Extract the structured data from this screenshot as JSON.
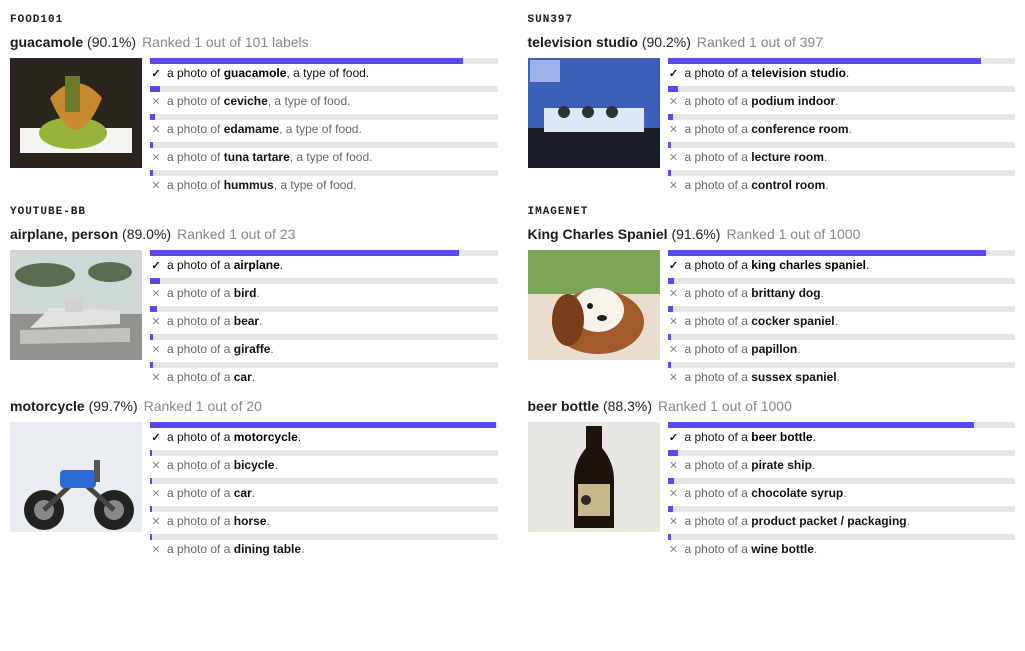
{
  "columns": [
    {
      "blocks": [
        {
          "dataset": "FOOD101",
          "examples": [
            {
              "label": "guacamole",
              "score": "(90.1%)",
              "rank": "Ranked 1 out of 101 labels",
              "thumb": "guacamole",
              "predictions": [
                {
                  "prefix": "a photo of ",
                  "bold": "guacamole",
                  "suffix": ", a type of food.",
                  "pct": 90.1,
                  "correct": true
                },
                {
                  "prefix": "a photo of ",
                  "bold": "ceviche",
                  "suffix": ", a type of food.",
                  "pct": 3,
                  "correct": false
                },
                {
                  "prefix": "a photo of ",
                  "bold": "edamame",
                  "suffix": ", a type of food.",
                  "pct": 1.5,
                  "correct": false
                },
                {
                  "prefix": "a photo of ",
                  "bold": "tuna tartare",
                  "suffix": ", a type of food.",
                  "pct": 1,
                  "correct": false
                },
                {
                  "prefix": "a photo of ",
                  "bold": "hummus",
                  "suffix": ", a type of food.",
                  "pct": 1,
                  "correct": false
                }
              ]
            }
          ]
        },
        {
          "dataset": "YOUTUBE-BB",
          "examples": [
            {
              "label": "airplane, person",
              "score": "(89.0%)",
              "rank": "Ranked 1 out of 23",
              "thumb": "airplane",
              "predictions": [
                {
                  "prefix": "a photo of a ",
                  "bold": "airplane",
                  "suffix": ".",
                  "pct": 89.0,
                  "correct": true
                },
                {
                  "prefix": "a photo of a ",
                  "bold": "bird",
                  "suffix": ".",
                  "pct": 3,
                  "correct": false
                },
                {
                  "prefix": "a photo of a ",
                  "bold": "bear",
                  "suffix": ".",
                  "pct": 2,
                  "correct": false
                },
                {
                  "prefix": "a photo of a ",
                  "bold": "giraffe",
                  "suffix": ".",
                  "pct": 1,
                  "correct": false
                },
                {
                  "prefix": "a photo of a ",
                  "bold": "car",
                  "suffix": ".",
                  "pct": 1,
                  "correct": false
                }
              ]
            },
            {
              "label": "motorcycle",
              "score": "(99.7%)",
              "rank": "Ranked 1 out of 20",
              "thumb": "motorcycle",
              "predictions": [
                {
                  "prefix": "a photo of a ",
                  "bold": "motorcycle",
                  "suffix": ".",
                  "pct": 99.7,
                  "correct": true
                },
                {
                  "prefix": "a photo of a ",
                  "bold": "bicycle",
                  "suffix": ".",
                  "pct": 0.1,
                  "correct": false
                },
                {
                  "prefix": "a photo of a ",
                  "bold": "car",
                  "suffix": ".",
                  "pct": 0.1,
                  "correct": false
                },
                {
                  "prefix": "a photo of a ",
                  "bold": "horse",
                  "suffix": ".",
                  "pct": 0.05,
                  "correct": false
                },
                {
                  "prefix": "a photo of a ",
                  "bold": "dining table",
                  "suffix": ".",
                  "pct": 0.05,
                  "correct": false
                }
              ]
            }
          ]
        }
      ]
    },
    {
      "blocks": [
        {
          "dataset": "SUN397",
          "examples": [
            {
              "label": "television studio",
              "score": "(90.2%)",
              "rank": "Ranked 1 out of 397",
              "thumb": "tvstudio",
              "predictions": [
                {
                  "prefix": "a photo of a ",
                  "bold": "television studio",
                  "suffix": ".",
                  "pct": 90.2,
                  "correct": true
                },
                {
                  "prefix": "a photo of a ",
                  "bold": "podium indoor",
                  "suffix": ".",
                  "pct": 3,
                  "correct": false
                },
                {
                  "prefix": "a photo of a ",
                  "bold": "conference room",
                  "suffix": ".",
                  "pct": 1.5,
                  "correct": false
                },
                {
                  "prefix": "a photo of a ",
                  "bold": "lecture room",
                  "suffix": ".",
                  "pct": 1,
                  "correct": false
                },
                {
                  "prefix": "a photo of a ",
                  "bold": "control room",
                  "suffix": ".",
                  "pct": 1,
                  "correct": false
                }
              ]
            }
          ]
        },
        {
          "dataset": "IMAGENET",
          "examples": [
            {
              "label": "King Charles Spaniel",
              "score": "(91.6%)",
              "rank": "Ranked 1 out of 1000",
              "thumb": "spaniel",
              "predictions": [
                {
                  "prefix": "a photo of a ",
                  "bold": "king charles spaniel",
                  "suffix": ".",
                  "pct": 91.6,
                  "correct": true
                },
                {
                  "prefix": "a photo of a ",
                  "bold": "brittany dog",
                  "suffix": ".",
                  "pct": 2,
                  "correct": false
                },
                {
                  "prefix": "a photo of a ",
                  "bold": "cocker spaniel",
                  "suffix": ".",
                  "pct": 1.5,
                  "correct": false
                },
                {
                  "prefix": "a photo of a ",
                  "bold": "papillon",
                  "suffix": ".",
                  "pct": 1,
                  "correct": false
                },
                {
                  "prefix": "a photo of a ",
                  "bold": "sussex spaniel",
                  "suffix": ".",
                  "pct": 1,
                  "correct": false
                }
              ]
            },
            {
              "label": "beer bottle",
              "score": "(88.3%)",
              "rank": "Ranked 1 out of 1000",
              "thumb": "beerbottle",
              "predictions": [
                {
                  "prefix": "a photo of a ",
                  "bold": "beer bottle",
                  "suffix": ".",
                  "pct": 88.3,
                  "correct": true
                },
                {
                  "prefix": "a photo of a ",
                  "bold": "pirate ship",
                  "suffix": ".",
                  "pct": 3,
                  "correct": false
                },
                {
                  "prefix": "a photo of a ",
                  "bold": "chocolate syrup",
                  "suffix": ".",
                  "pct": 2,
                  "correct": false
                },
                {
                  "prefix": "a photo of a ",
                  "bold": "product packet / packaging",
                  "suffix": ".",
                  "pct": 1.5,
                  "correct": false
                },
                {
                  "prefix": "a photo of a ",
                  "bold": "wine bottle",
                  "suffix": ".",
                  "pct": 1,
                  "correct": false
                }
              ]
            }
          ]
        }
      ]
    }
  ],
  "icons": {
    "check": "✓",
    "cross": "✕"
  }
}
